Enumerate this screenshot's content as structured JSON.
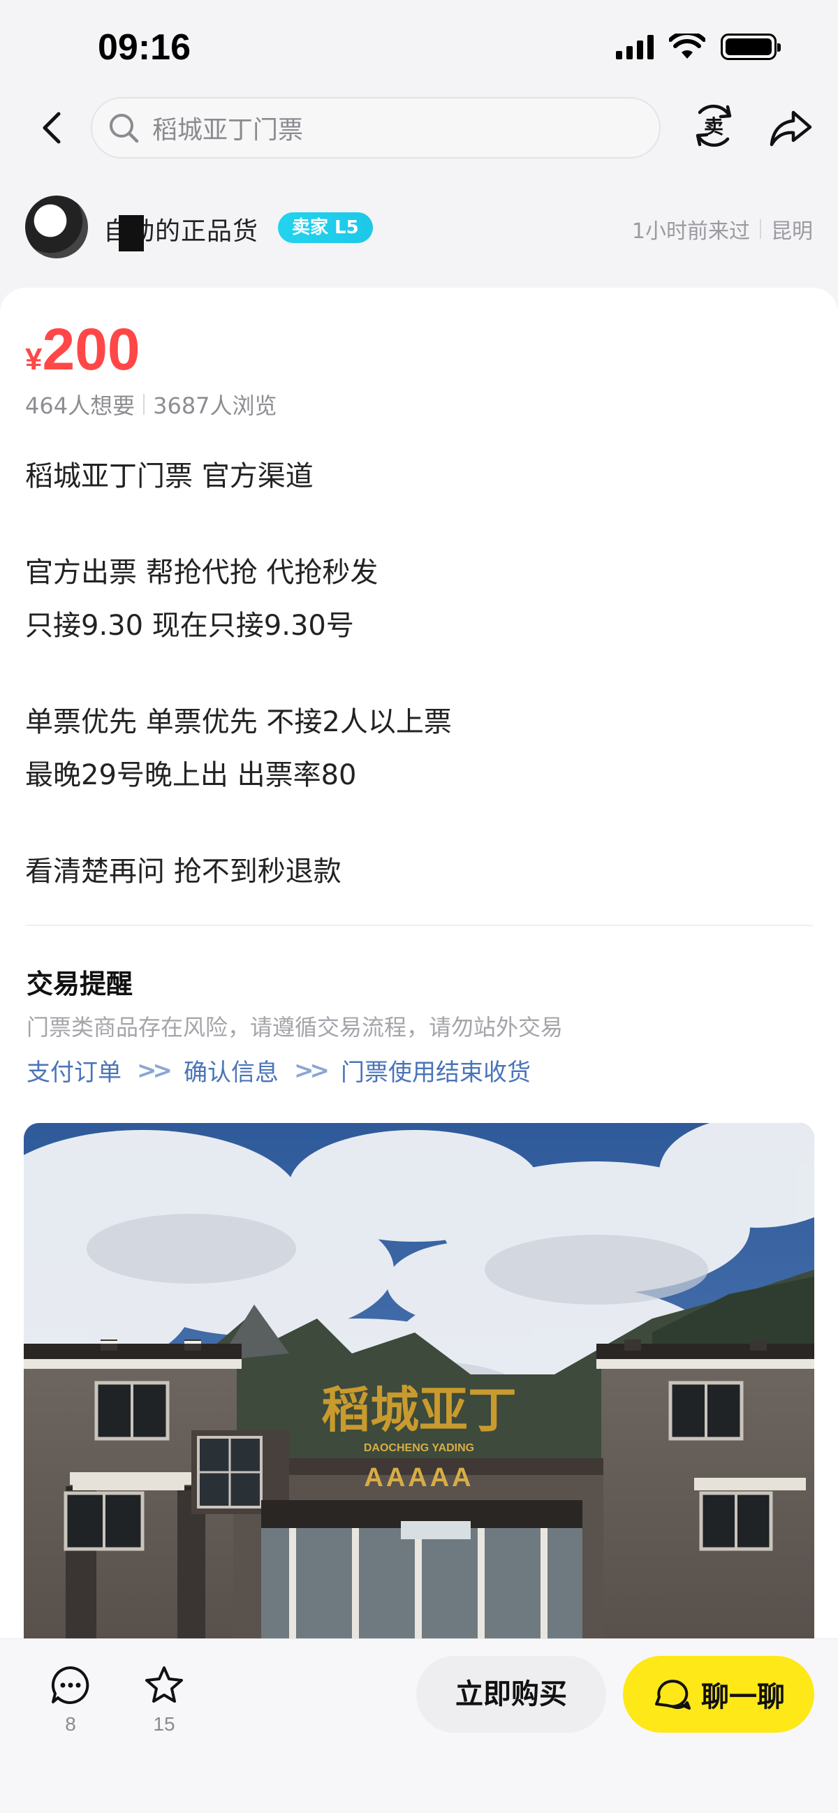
{
  "status_bar": {
    "time": "09:16"
  },
  "search": {
    "query": "稻城亚丁门票"
  },
  "header_icons": {
    "sell_icon": "sell-icon",
    "share_icon": "share-icon"
  },
  "seller": {
    "name": "自动的正品货",
    "badge": "卖家 L5",
    "last_seen": "1小时前来过",
    "location": "昆明"
  },
  "listing": {
    "price_symbol": "¥",
    "price": "200",
    "wants": "464人想要",
    "views": "3687人浏览",
    "description_lines": [
      "稻城亚丁门票  官方渠道",
      "",
      "官方出票  帮抢代抢 代抢秒发",
      "只接9.30 现在只接9.30号",
      "",
      "单票优先 单票优先 不接2人以上票",
      "最晚29号晚上出  出票率80",
      "",
      "看清楚再问  抢不到秒退款"
    ]
  },
  "trade_tips": {
    "title": "交易提醒",
    "text": "门票类商品存在风险，请遵循交易流程，请勿站外交易",
    "steps": [
      "支付订单",
      "确认信息",
      "门票使用结束收货"
    ]
  },
  "photo": {
    "gate_sign": "稻城亚丁",
    "gate_sign_en": "DAOCHENG YADING",
    "rating_sign": "AAAAA"
  },
  "bottom_bar": {
    "comments_count": "8",
    "favorites_count": "15",
    "buy_label": "立即购买",
    "chat_label": "聊一聊"
  },
  "colors": {
    "price": "#ff4747",
    "chat_button": "#ffe817",
    "badge": "#22d3ee",
    "link": "#4a74b8"
  }
}
